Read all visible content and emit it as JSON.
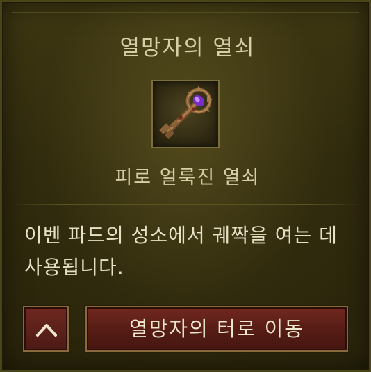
{
  "title": "열망자의 열쇠",
  "item": {
    "name": "피로 얼룩진 열쇠",
    "icon": "bloody-key-icon"
  },
  "description": "이벤 파드의 성소에서 궤짝을 여는 데 사용됩니다.",
  "buttons": {
    "up_icon": "chevron-up-icon",
    "go_label": "열망자의 터로 이동"
  },
  "colors": {
    "panel": "#2f2a0d",
    "text": "#d6cfa6",
    "button": "#5e2119",
    "border": "#8a6a3c"
  }
}
